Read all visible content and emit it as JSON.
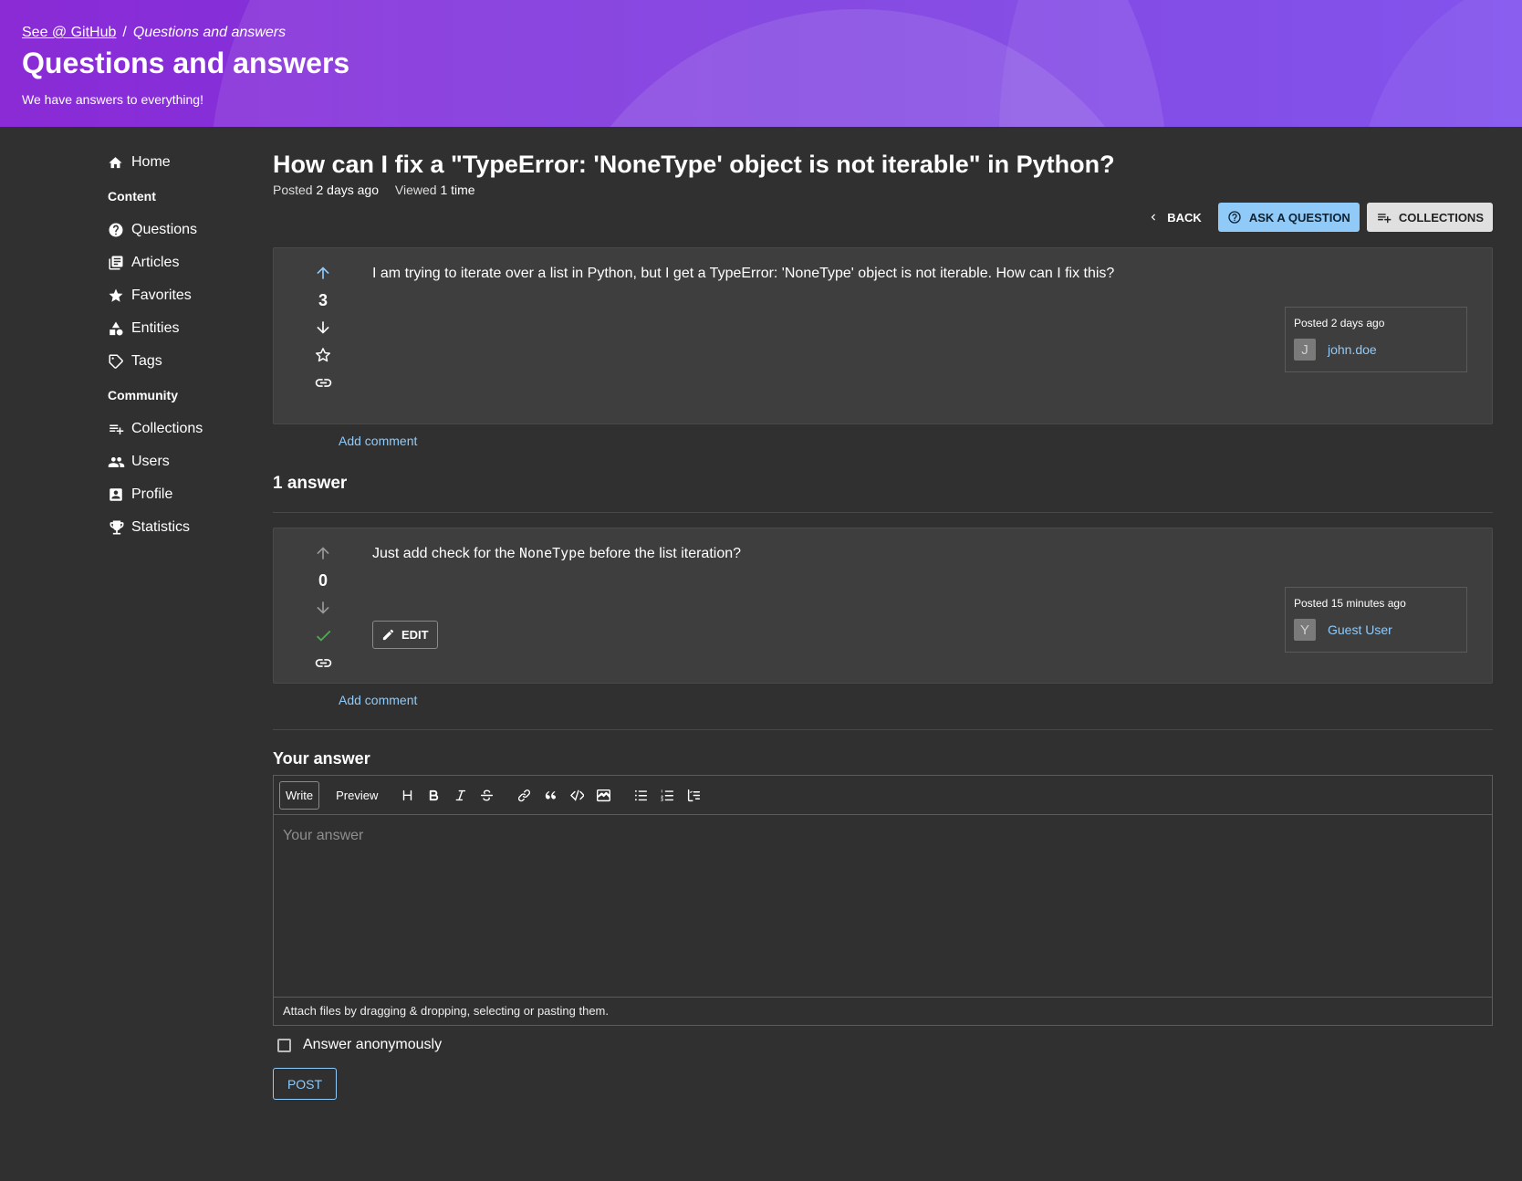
{
  "header": {
    "breadcrumb_link": "See @ GitHub",
    "breadcrumb_separator": "/",
    "breadcrumb_current": "Questions and answers",
    "title": "Questions and answers",
    "subtitle": "We have answers to everything!"
  },
  "sidebar": {
    "home": "Home",
    "section_content": "Content",
    "questions": "Questions",
    "articles": "Articles",
    "favorites": "Favorites",
    "entities": "Entities",
    "tags": "Tags",
    "section_community": "Community",
    "collections": "Collections",
    "users": "Users",
    "profile": "Profile",
    "statistics": "Statistics"
  },
  "question": {
    "title": "How can I fix a \"TypeError: 'NoneType' object is not iterable\" in Python?",
    "posted_label": "Posted",
    "posted_value": "2 days ago",
    "viewed_label": "Viewed",
    "viewed_value": "1 time",
    "body": "I am trying to iterate over a list in Python, but I get a TypeError: 'NoneType' object is not iterable. How can I fix this?",
    "votes": "3",
    "author_posted": "Posted 2 days ago",
    "author_initial": "J",
    "author_name": "john.doe",
    "add_comment": "Add comment"
  },
  "actions": {
    "back": "Back",
    "ask": "Ask a question",
    "collections": "Collections"
  },
  "answers": {
    "heading": "1 answer",
    "items": [
      {
        "votes": "0",
        "body_prefix": "Just add check for the",
        "body_code": "NoneType",
        "body_suffix": "before the list iteration?",
        "edit": "Edit",
        "author_posted": "Posted 15 minutes ago",
        "author_initial": "Y",
        "author_name": "Guest User",
        "add_comment": "Add comment",
        "accepted_color": "#4caf50"
      }
    ]
  },
  "editor": {
    "heading": "Your answer",
    "tab_write": "Write",
    "tab_preview": "Preview",
    "placeholder": "Your answer",
    "attach_hint": "Attach files by dragging & dropping, selecting or pasting them.",
    "anonymous_label": "Answer anonymously",
    "post": "Post",
    "tools": [
      "heading-icon",
      "bold-icon",
      "italic-icon",
      "strikethrough-icon",
      "link-icon",
      "quote-icon",
      "code-icon",
      "image-icon",
      "bullet-list-icon",
      "numbered-list-icon",
      "task-list-icon"
    ]
  },
  "colors": {
    "accent": "#90caf9",
    "background": "#303030",
    "card": "#3e3e3e",
    "header_gradient_start": "#8a2bd6",
    "header_gradient_end": "#7a47ec"
  }
}
